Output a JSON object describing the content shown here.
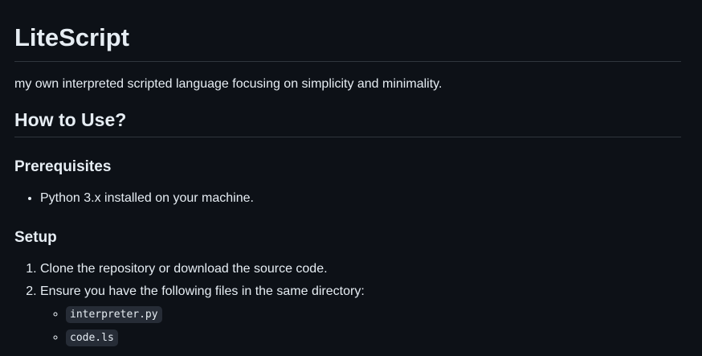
{
  "readme": {
    "title": "LiteScript",
    "description": "my own interpreted scripted language focusing on simplicity and minimality.",
    "how_to_use": {
      "heading": "How to Use?"
    },
    "prerequisites": {
      "heading": "Prerequisites",
      "items": [
        "Python 3.x installed on your machine."
      ]
    },
    "setup": {
      "heading": "Setup",
      "steps": [
        "Clone the repository or download the source code.",
        "Ensure you have the following files in the same directory:"
      ],
      "files": [
        "interpreter.py",
        "code.ls"
      ]
    }
  }
}
